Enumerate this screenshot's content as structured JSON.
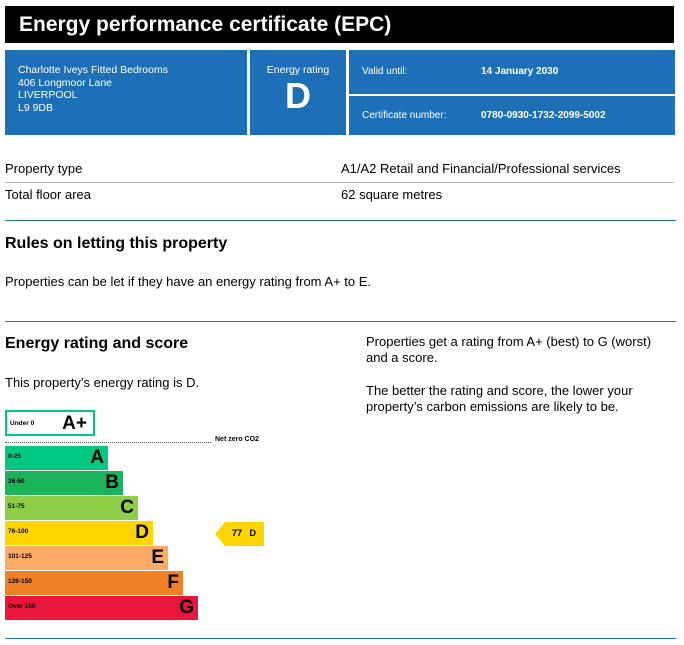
{
  "header": {
    "title": "Energy performance certificate (EPC)"
  },
  "address": {
    "line1": "Charlotte Iveys Fitted Bedrooms",
    "line2": "406 Longmoor Lane",
    "line3": "LIVERPOOL",
    "line4": "L9 9DB"
  },
  "rating_box": {
    "label": "Energy rating",
    "value": "D"
  },
  "valid": {
    "label": "Valid until:",
    "value": "14 January 2030"
  },
  "certificate": {
    "label": "Certificate number:",
    "value": "0780-0930-1732-2099-5002"
  },
  "property": {
    "type_label": "Property type",
    "type_value": "A1/A2 Retail and Financial/Professional services",
    "area_label": "Total floor area",
    "area_value": "62 square metres"
  },
  "letting": {
    "heading": "Rules on letting this property",
    "text": "Properties can be let if they have an energy rating from A+ to E."
  },
  "energy": {
    "heading": "Energy rating and score",
    "text": "This property’s energy rating is D.",
    "right1": "Properties get a rating from A+ (best) to G (worst) and a score.",
    "right2": "The better the rating and score, the lower your property’s carbon emissions are likely to be."
  },
  "scale": {
    "aplus": {
      "range": "Under 0",
      "letter": "A+",
      "color": "#00c781"
    },
    "net_zero": "Net zero CO2",
    "bands": [
      {
        "range": "0-25",
        "letter": "A",
        "color": "#00c781"
      },
      {
        "range": "26-50",
        "letter": "B",
        "color": "#19b459"
      },
      {
        "range": "51-75",
        "letter": "C",
        "color": "#8dce46"
      },
      {
        "range": "76-100",
        "letter": "D",
        "color": "#ffd500"
      },
      {
        "range": "101-125",
        "letter": "E",
        "color": "#fcaa65"
      },
      {
        "range": "126-150",
        "letter": "F",
        "color": "#ef8023"
      },
      {
        "range": "Over 150",
        "letter": "G",
        "color": "#e9153b"
      }
    ],
    "current": {
      "score": "77",
      "letter": "D",
      "color": "#ffd500"
    }
  }
}
